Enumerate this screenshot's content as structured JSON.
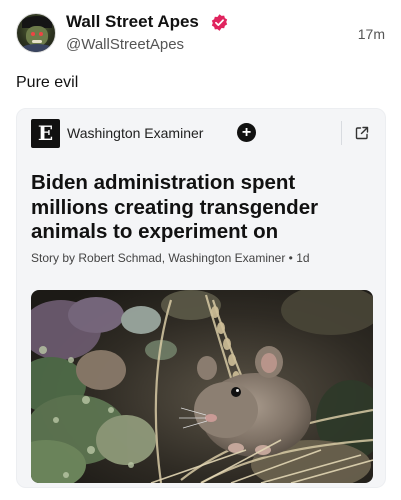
{
  "author": {
    "display_name": "Wall Street Apes",
    "handle": "@WallStreetApes",
    "timestamp": "17m",
    "verified_color": "#e0245e"
  },
  "post": {
    "text": "Pure evil"
  },
  "card": {
    "source_logo_glyph": "E",
    "source_name": "Washington Examiner",
    "follow_glyph": "+",
    "headline": "Biden administration spent millions creating transgender animals to experiment on",
    "byline": "Story by Robert Schmad, Washington Examiner • 1d",
    "icons": [
      "follow-icon",
      "open-external-icon"
    ],
    "image_subject": "mouse"
  },
  "colors": {
    "card_background": "#f4f5f7",
    "text_primary": "#111111",
    "text_secondary": "#555555"
  }
}
